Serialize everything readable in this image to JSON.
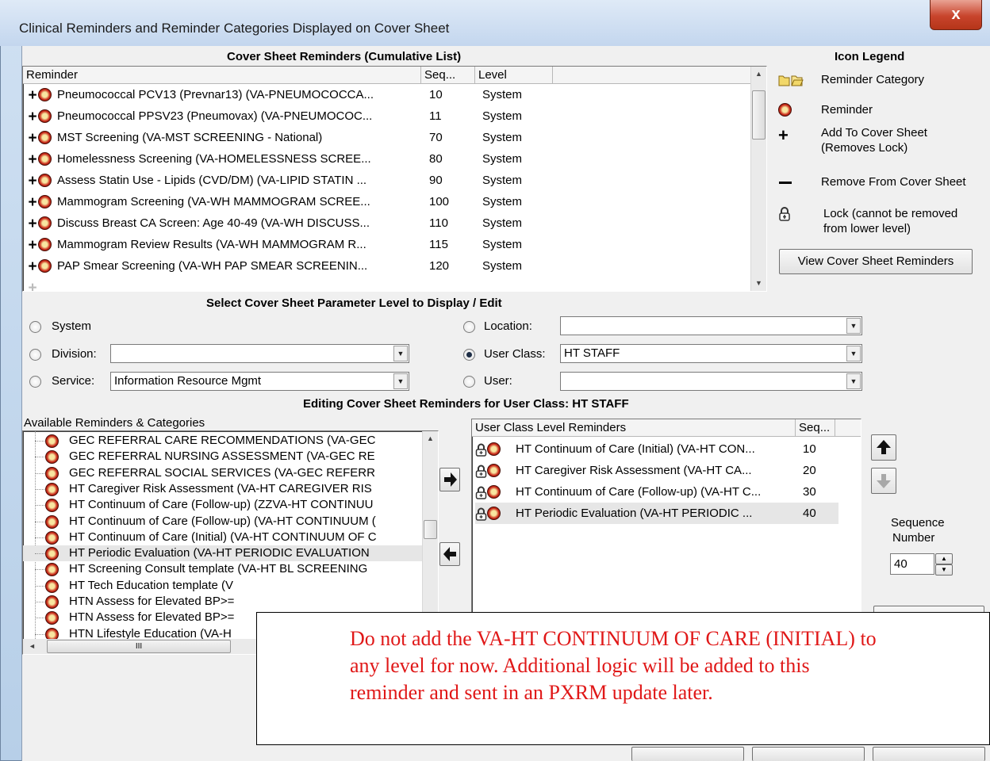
{
  "window": {
    "title": "Clinical Reminders and Reminder Categories Displayed on Cover Sheet",
    "close_label": "x"
  },
  "cumulative": {
    "heading": "Cover Sheet Reminders (Cumulative List)",
    "columns": [
      "Reminder",
      "Seq...",
      "Level"
    ],
    "rows": [
      {
        "name": "Pneumococcal PCV13 (Prevnar13) (VA-PNEUMOCOCCA...",
        "seq": "10",
        "level": "System"
      },
      {
        "name": "Pneumococcal PPSV23 (Pneumovax) (VA-PNEUMOCOC...",
        "seq": "11",
        "level": "System"
      },
      {
        "name": "MST Screening (VA-MST SCREENING - National)",
        "seq": "70",
        "level": "System"
      },
      {
        "name": "Homelessness Screening (VA-HOMELESSNESS SCREE...",
        "seq": "80",
        "level": "System"
      },
      {
        "name": "Assess Statin Use - Lipids (CVD/DM) (VA-LIPID STATIN ...",
        "seq": "90",
        "level": "System"
      },
      {
        "name": "Mammogram Screening (VA-WH MAMMOGRAM SCREE...",
        "seq": "100",
        "level": "System"
      },
      {
        "name": "Discuss Breast CA Screen: Age 40-49 (VA-WH DISCUSS...",
        "seq": "110",
        "level": "System"
      },
      {
        "name": "Mammogram Review Results (VA-WH MAMMOGRAM R...",
        "seq": "115",
        "level": "System"
      },
      {
        "name": "PAP Smear Screening (VA-WH PAP SMEAR SCREENIN...",
        "seq": "120",
        "level": "System"
      }
    ]
  },
  "legend": {
    "heading": "Icon Legend",
    "category": "Reminder Category",
    "reminder": "Reminder",
    "add_line1": "Add To Cover Sheet",
    "add_line2": "(Removes Lock)",
    "remove": "Remove From Cover Sheet",
    "lock_line1": "Lock (cannot be removed",
    "lock_line2": "from lower level)",
    "view_button": "View Cover Sheet Reminders"
  },
  "param": {
    "heading": "Select Cover Sheet Parameter Level to Display / Edit",
    "system": "System",
    "division": "Division:",
    "division_value": "",
    "service": "Service:",
    "service_value": "Information Resource Mgmt",
    "location": "Location:",
    "location_value": "",
    "user_class": "User Class:",
    "user_class_value": "HT STAFF",
    "user": "User:",
    "user_value": "",
    "selected": "User Class"
  },
  "editing": {
    "heading": "Editing Cover Sheet Reminders for User Class: HT STAFF"
  },
  "available": {
    "heading": "Available Reminders & Categories",
    "items": [
      "GEC REFERRAL CARE RECOMMENDATIONS (VA-GEC",
      "GEC REFERRAL NURSING ASSESSMENT (VA-GEC RE",
      "GEC REFERRAL SOCIAL SERVICES (VA-GEC REFERR",
      "HT Caregiver Risk Assessment (VA-HT CAREGIVER RIS",
      "HT Continuum of Care (Follow-up) (ZZVA-HT CONTINUU",
      "HT Continuum of Care (Follow-up) (VA-HT CONTINUUM (",
      "HT Continuum of Care (Initial) (VA-HT CONTINUUM OF C",
      "HT Periodic Evaluation (VA-HT PERIODIC EVALUATION",
      "HT Screening Consult template (VA-HT BL SCREENING",
      "HT Tech Education template (V",
      "HTN Assess for Elevated BP>=",
      "HTN Assess for Elevated BP>=",
      "HTN Lifestyle Education (VA-H"
    ],
    "hscroll_thumb": "III"
  },
  "userclass": {
    "columns": [
      "User Class Level Reminders",
      "Seq..."
    ],
    "rows": [
      {
        "name": "HT Continuum of Care (Initial) (VA-HT CON...",
        "seq": "10"
      },
      {
        "name": "HT Caregiver Risk Assessment (VA-HT CA...",
        "seq": "20"
      },
      {
        "name": "HT Continuum of Care (Follow-up) (VA-HT C...",
        "seq": "30"
      },
      {
        "name": "HT Periodic Evaluation (VA-HT PERIODIC ...",
        "seq": "40"
      }
    ]
  },
  "sequence": {
    "label1": "Sequence",
    "label2": "Number",
    "value": "40"
  },
  "note": {
    "line1": "Do not add the VA-HT CONTINUUM OF CARE (INITIAL) to",
    "line2": "any level for now. Additional logic will be added to this",
    "line3": "reminder and sent in an PXRM update later."
  },
  "colors": {
    "note_text": "#e01818",
    "titlebar": "#c3d6ee",
    "close": "#c8442c"
  }
}
